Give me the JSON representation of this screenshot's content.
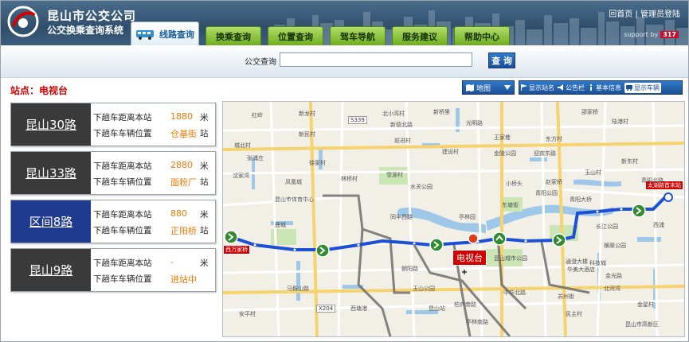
{
  "header": {
    "title": "昆山市公交公司",
    "subtitle": "公交换乘查询系统",
    "links": [
      "回首页",
      "管理员登陆"
    ],
    "support_label": "support by",
    "support_badge": "317"
  },
  "tabs": [
    {
      "label": "线路查询",
      "active": true,
      "icon": "bus-icon"
    },
    {
      "label": "换乘查询",
      "active": false
    },
    {
      "label": "位置查询",
      "active": false
    },
    {
      "label": "驾车导航",
      "active": false
    },
    {
      "label": "服务建议",
      "active": false
    },
    {
      "label": "帮助中心",
      "active": false
    }
  ],
  "search": {
    "label": "公交查询",
    "value": "",
    "button": "查 询"
  },
  "station": {
    "label": "站点：电视台"
  },
  "map_controls": {
    "map_button": "地图",
    "toolbar": [
      {
        "label": "显示站名",
        "icon": "flag-icon"
      },
      {
        "label": "公告栏",
        "icon": "megaphone-icon"
      },
      {
        "label": "基本信息",
        "icon": "info-icon"
      },
      {
        "label": "显示车辆",
        "icon": "bus-icon",
        "active": true
      }
    ]
  },
  "routes": [
    {
      "name": "昆山30路",
      "label_distance": "下趟车距离本站",
      "distance": "1880",
      "unit": "米",
      "label_position": "下趟车车辆位置",
      "position": "仓基街",
      "position_suffix": "站",
      "selected": false
    },
    {
      "name": "昆山33路",
      "label_distance": "下趟车距离本站",
      "distance": "2880",
      "unit": "米",
      "label_position": "下趟车车辆位置",
      "position": "面粉厂",
      "position_suffix": "站",
      "selected": false
    },
    {
      "name": "区间8路",
      "label_distance": "下趟车距离本站",
      "distance": "880",
      "unit": "米",
      "label_position": "下趟车车辆位置",
      "position": "正阳桥",
      "position_suffix": "站",
      "selected": true
    },
    {
      "name": "昆山9路",
      "label_distance": "下趟车距离本站",
      "distance": "-",
      "unit": "米",
      "label_position": "下趟车车辆位置",
      "position": "进站中",
      "position_suffix": "",
      "selected": false
    }
  ],
  "map": {
    "station_tag": "电视台",
    "left_end_tag": "西万家桥",
    "right_end_tag": "太湖路首末站",
    "road_tags": [
      "S339",
      "X204"
    ],
    "labels": [
      "红岭",
      "新龙村",
      "北小湾村",
      "新桥里",
      "邵家桥",
      "新德北路",
      "光明路",
      "新民村",
      "陆港村",
      "城北村",
      "前进村",
      "王家巷",
      "东方村",
      "张浦庄",
      "徐家村",
      "建设村",
      "金陵公园",
      "迎宾东路",
      "新东村",
      "沈家湾",
      "凤凰城",
      "林桥村",
      "玉山村",
      "赵家桥",
      "小桥头",
      "青阳北路",
      "雪源村",
      "水关公园",
      "鹿城",
      "昆山市体育中心",
      "同丰西路",
      "亭林园",
      "东塘街",
      "青阳公园",
      "青阳大桥",
      "长江公园",
      "西浦",
      "昆山城市公园",
      "通澄大楼",
      "华美大酒店",
      "横渠公园",
      "科技城",
      "金光路",
      "昆山站",
      "北河湾",
      "西塘港",
      "玉山公园",
      "朝阳路",
      "苏州街",
      "金星村",
      "亭林南路",
      "安平村",
      "中华北路",
      "民主村",
      "昆山市高新区",
      "马鞍山路",
      "柏庐南路"
    ]
  }
}
